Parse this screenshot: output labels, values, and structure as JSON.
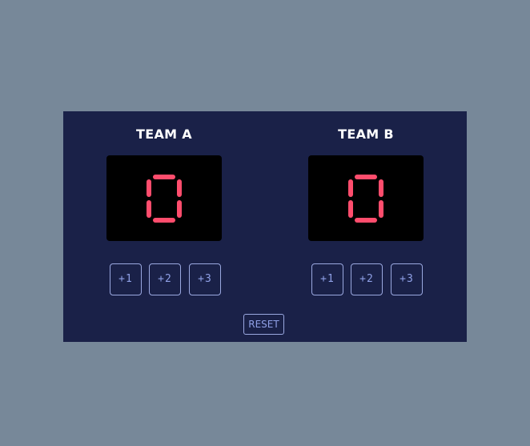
{
  "colors": {
    "page_background": "#778899",
    "board_background": "#1a2148",
    "display_background": "#000000",
    "digit": "#ff4d6d",
    "button_border": "#9aa8e0",
    "button_text": "#8fa0e6",
    "team_name": "#ffffff"
  },
  "teams": [
    {
      "name": "TEAM A",
      "score": 0,
      "buttons": [
        "+1",
        "+2",
        "+3"
      ]
    },
    {
      "name": "TEAM B",
      "score": 0,
      "buttons": [
        "+1",
        "+2",
        "+3"
      ]
    }
  ],
  "reset_label": "RESET"
}
